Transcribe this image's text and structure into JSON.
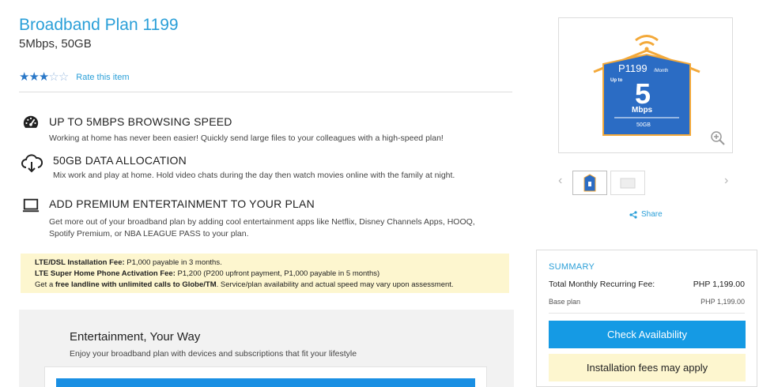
{
  "product": {
    "title": "Broadband Plan 1199",
    "subtitle": "5Mbps, 50GB",
    "rating": {
      "value": 3,
      "max": 5,
      "link_label": "Rate this item"
    }
  },
  "features": [
    {
      "icon": "speedometer-icon",
      "heading": "UP TO 5MBPS BROWSING SPEED",
      "description": "Working at home has never been easier! Quickly send large files to your colleagues with a high-speed plan!"
    },
    {
      "icon": "cloud-download-icon",
      "heading": "50GB DATA ALLOCATION",
      "description": "Mix work and play at home. Hold video chats during the day then watch movies online with the family at night."
    },
    {
      "icon": "laptop-icon",
      "heading": "ADD PREMIUM ENTERTAINMENT TO YOUR PLAN",
      "description": "Get more out of your broadband plan by adding cool entertainment apps like Netflix, Disney Channels Apps, HOOQ, Spotify Premium, or NBA LEAGUE PASS to your plan."
    }
  ],
  "fees": {
    "line1_label": "LTE/DSL Installation Fee:",
    "line1_value": " P1,000 payable in 3 months.",
    "line2_label": "LTE Super Home Phone Activation Fee:",
    "line2_value": " P1,200 (P200 upfront payment, P1,000 payable in 5 months)",
    "line3_pre": "Get a ",
    "line3_bold": "free landline with unlimited calls to Globe/TM",
    "line3_post": ". Service/plan availability and actual speed may vary upon assessment."
  },
  "entertainment": {
    "title": "Entertainment, Your Way",
    "subtitle": "Enjoy your broadband plan with devices and subscriptions that fit your lifestyle"
  },
  "product_image": {
    "price": "P1199",
    "per": "/Month",
    "up_to": "Up to",
    "speed": "5",
    "unit": "Mbps",
    "data": "50GB",
    "colors": {
      "house": "#2b6cc4",
      "roof": "#f3a93a"
    }
  },
  "share_label": "Share",
  "summary": {
    "title": "SUMMARY",
    "total_label": "Total Monthly Recurring Fee:",
    "total_value": "PHP 1,199.00",
    "base_label": "Base plan",
    "base_value": "PHP 1,199.00",
    "check_button": "Check Availability",
    "fee_note": "Installation fees may apply"
  },
  "colors": {
    "accent": "#2a9fd8",
    "button": "#159ae4",
    "note_bg": "#fdf6cf"
  }
}
